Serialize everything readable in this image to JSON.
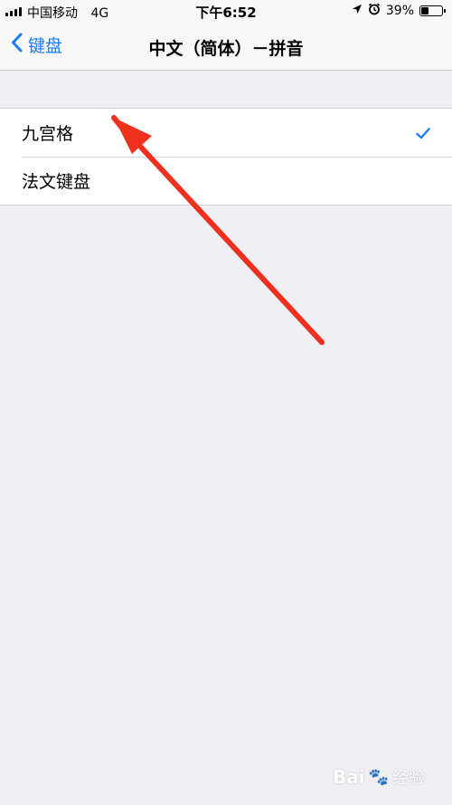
{
  "status_bar": {
    "carrier": "中国移动",
    "network": "4G",
    "time": "下午6:52",
    "battery_percent": "39%",
    "battery_level": 0.39,
    "icons": [
      "signal-icon",
      "location-arrow-icon",
      "alarm-icon",
      "battery-icon"
    ]
  },
  "nav": {
    "back_label": "键盘",
    "title": "中文（简体）－拼音"
  },
  "list": {
    "items": [
      {
        "label": "九宫格",
        "selected": true
      },
      {
        "label": "法文键盘",
        "selected": false
      }
    ]
  },
  "colors": {
    "accent": "#1a7cf5",
    "annotation": "#f0301e",
    "background": "#efeff4"
  },
  "watermark": {
    "brand": "Bai",
    "paw_glyph": "🐾",
    "suffix": "经验"
  }
}
